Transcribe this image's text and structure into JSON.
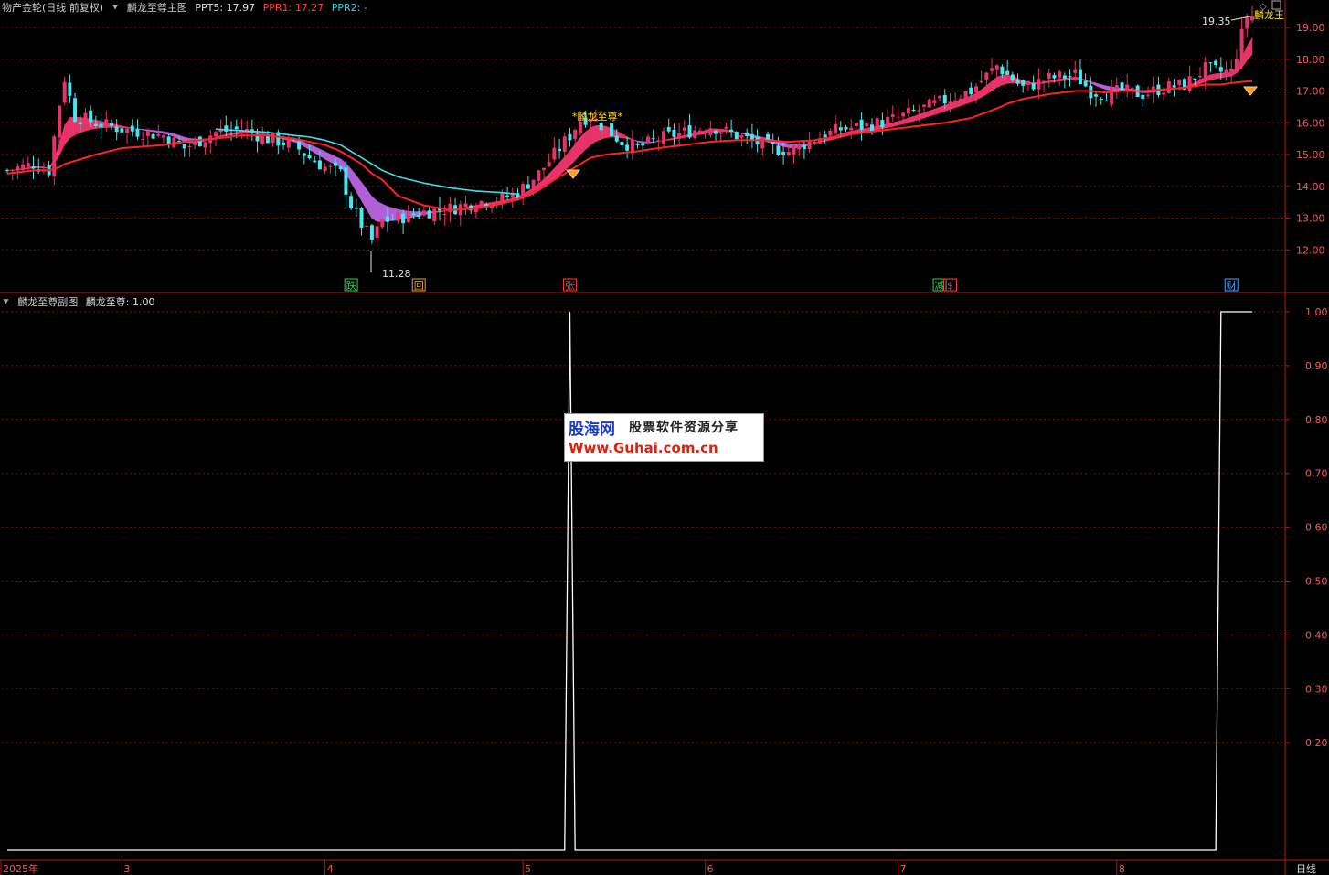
{
  "main_header": {
    "title": "物产金轮(日线 前复权)",
    "indicator_name": "麟龙至尊主图",
    "items": [
      {
        "label": "PPT5: 17.97",
        "color": "#e0e0e0"
      },
      {
        "label": "PPR1: 17.27",
        "color": "#ff3b3b"
      },
      {
        "label": "PPR2: -",
        "color": "#33d6e6"
      }
    ]
  },
  "sub_header": {
    "indicator_name": "麟龙至尊副图",
    "value_label": "麟龙至尊: 1.00"
  },
  "annotations": {
    "high_label": "19.35",
    "low_label": "11.28",
    "signal_label": "*麟龙至尊*",
    "corner_label": "麟龙王"
  },
  "markers": [
    {
      "text": "跌",
      "bar": 66,
      "color": "#2bd15a"
    },
    {
      "text": "回",
      "bar": 79,
      "color": "#e8a030"
    },
    {
      "text": "张",
      "bar": 108,
      "color": "#ff3b3b"
    },
    {
      "text": "减",
      "bar": 179,
      "color": "#2bd15a"
    },
    {
      "text": "$",
      "bar": 181,
      "color": "#ff3b3b"
    },
    {
      "text": "财",
      "bar": 235,
      "color": "#4aa0ff"
    }
  ],
  "xaxis": {
    "year_label": "2025年",
    "months": [
      {
        "label": "3",
        "bar": 22
      },
      {
        "label": "4",
        "bar": 61
      },
      {
        "label": "5",
        "bar": 99
      },
      {
        "label": "6",
        "bar": 134
      },
      {
        "label": "7",
        "bar": 171
      },
      {
        "label": "8",
        "bar": 213
      }
    ],
    "period_label": "日线"
  },
  "watermark": {
    "brand": "股海网",
    "slogan": "股票软件资源分享",
    "url": "Www.Guhai.com.cn"
  },
  "colors": {
    "up": "#e8336a",
    "down": "#48e6ee",
    "ma_red": "#ff2222",
    "ma_cyan": "#3ee0e6",
    "ribbon_up": "#e8336a",
    "ribbon_down": "#b060d8",
    "grid": "#7a1010",
    "axis": "#b01818",
    "tick_text": "#ff5555",
    "line_white": "#ffffff"
  },
  "chart_data": [
    {
      "type": "candlestick",
      "title": "麟龙至尊主图",
      "ylim": [
        11.0,
        19.4
      ],
      "yticks": [
        12.0,
        13.0,
        14.0,
        15.0,
        16.0,
        17.0,
        18.0,
        19.0
      ],
      "bars": 240,
      "anchors_bar": [
        0,
        5,
        8,
        10,
        11,
        13,
        17,
        22,
        30,
        34,
        40,
        45,
        50,
        55,
        58,
        61,
        64,
        66,
        68,
        70,
        72,
        75,
        80,
        85,
        90,
        95,
        98,
        100,
        102,
        104,
        106,
        108,
        110,
        112,
        115,
        118,
        121,
        125,
        130,
        135,
        140,
        145,
        150,
        155,
        160,
        165,
        170,
        175,
        180,
        185,
        190,
        192,
        195,
        200,
        205,
        208,
        211,
        214,
        218,
        222,
        226,
        230,
        233,
        235,
        238
      ],
      "anchors_close": [
        14.5,
        14.7,
        14.5,
        16.6,
        17.4,
        16.2,
        16.0,
        15.8,
        15.6,
        15.2,
        15.7,
        15.8,
        15.5,
        15.3,
        14.9,
        14.6,
        14.4,
        13.4,
        12.8,
        12.3,
        12.9,
        13.0,
        13.2,
        13.3,
        13.5,
        13.6,
        13.8,
        14.1,
        14.4,
        14.8,
        15.2,
        15.6,
        16.1,
        16.2,
        15.8,
        15.4,
        15.2,
        15.5,
        15.7,
        15.9,
        15.6,
        15.3,
        15.1,
        15.5,
        15.8,
        15.9,
        16.1,
        16.4,
        16.7,
        17.0,
        17.8,
        17.5,
        17.1,
        17.4,
        17.5,
        17.0,
        16.9,
        17.0,
        16.9,
        17.1,
        17.2,
        17.7,
        17.6,
        17.6,
        19.35
      ],
      "anchors_ma": [
        14.4,
        14.5,
        14.5,
        14.6,
        14.7,
        14.8,
        15.0,
        15.2,
        15.3,
        15.4,
        15.5,
        15.6,
        15.6,
        15.5,
        15.4,
        15.3,
        15.1,
        14.9,
        14.7,
        14.4,
        14.2,
        13.7,
        13.4,
        13.25,
        13.3,
        13.45,
        13.6,
        13.75,
        13.9,
        14.1,
        14.3,
        14.5,
        14.7,
        14.9,
        15.0,
        15.05,
        15.1,
        15.2,
        15.3,
        15.4,
        15.45,
        15.45,
        15.4,
        15.45,
        15.6,
        15.7,
        15.8,
        15.9,
        16.0,
        16.15,
        16.45,
        16.6,
        16.75,
        16.9,
        17.0,
        17.0,
        16.95,
        17.0,
        17.0,
        17.05,
        17.1,
        17.2,
        17.2,
        17.25,
        17.3
      ],
      "anchors_cyan_bar": [
        40,
        45,
        50,
        55,
        58,
        61,
        64,
        66,
        68,
        70,
        72,
        75,
        80,
        85,
        90,
        95,
        98
      ],
      "anchors_cyan": [
        15.8,
        15.75,
        15.7,
        15.6,
        15.55,
        15.45,
        15.3,
        15.1,
        14.9,
        14.7,
        14.5,
        14.3,
        14.1,
        13.95,
        13.85,
        13.8,
        13.75
      ]
    },
    {
      "type": "line",
      "title": "麟龙至尊副图",
      "series": [
        {
          "name": "麟龙至尊",
          "value_bars": [
            0,
            107,
            108,
            109,
            232,
            233
          ],
          "values": [
            0,
            0,
            1,
            0,
            0,
            1
          ]
        }
      ],
      "ylim": [
        0.0,
        1.0
      ],
      "yticks": [
        0.2,
        0.3,
        0.4,
        0.5,
        0.6,
        0.7,
        0.8,
        0.9,
        1.0
      ]
    }
  ]
}
